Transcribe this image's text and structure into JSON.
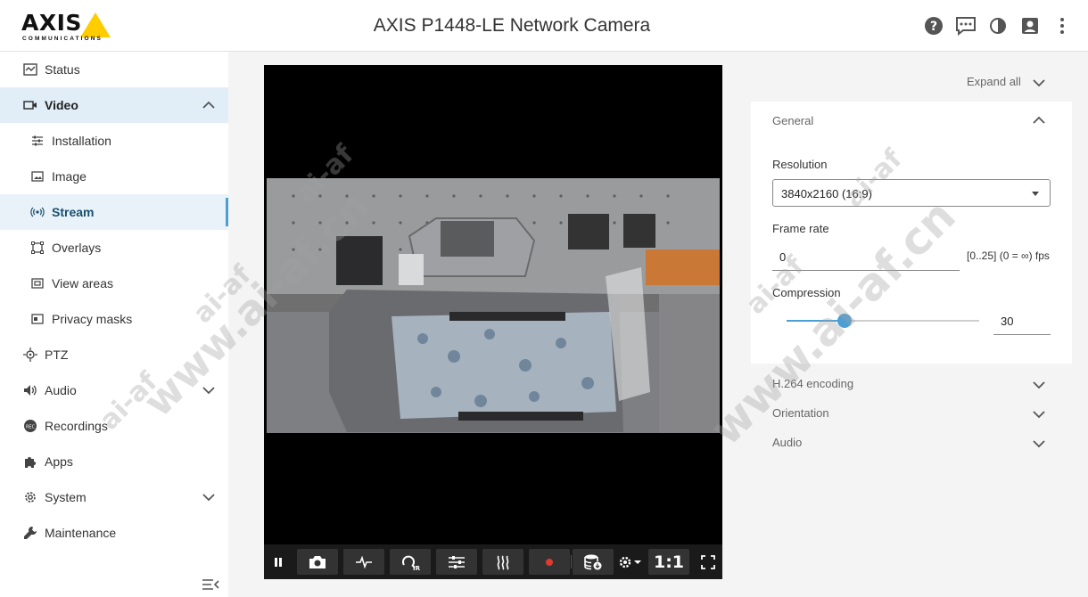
{
  "header": {
    "logo_text": "AXIS",
    "logo_sub": "COMMUNICATIONS",
    "title": "AXIS P1448-LE Network Camera",
    "icons": [
      "help-icon",
      "feedback-icon",
      "contrast-icon",
      "user-icon",
      "more-vertical-icon"
    ]
  },
  "sidebar": {
    "items": [
      {
        "label": "Status",
        "icon": "status-icon"
      },
      {
        "label": "Video",
        "icon": "video-icon"
      },
      {
        "label": "Installation",
        "icon": "sliders-icon"
      },
      {
        "label": "Image",
        "icon": "image-icon"
      },
      {
        "label": "Stream",
        "icon": "stream-icon"
      },
      {
        "label": "Overlays",
        "icon": "overlays-icon"
      },
      {
        "label": "View areas",
        "icon": "view-areas-icon"
      },
      {
        "label": "Privacy masks",
        "icon": "privacy-masks-icon"
      },
      {
        "label": "PTZ",
        "icon": "ptz-icon"
      },
      {
        "label": "Audio",
        "icon": "audio-icon"
      },
      {
        "label": "Recordings",
        "icon": "recordings-icon"
      },
      {
        "label": "Apps",
        "icon": "apps-icon"
      },
      {
        "label": "System",
        "icon": "system-icon"
      },
      {
        "label": "Maintenance",
        "icon": "maintenance-icon"
      }
    ]
  },
  "video": {
    "zoom_label": "1:1",
    "toolbar_icons": [
      "pause-icon",
      "snapshot-icon",
      "pulse-icon",
      "ir-icon",
      "adjust-icon",
      "heat-icon",
      "record-icon",
      "storage-icon",
      "settings-icon",
      "fullscreen-icon"
    ]
  },
  "panel": {
    "expand_all": "Expand all",
    "general_title": "General",
    "resolution_label": "Resolution",
    "resolution_value": "3840x2160 (16:9)",
    "frame_rate_label": "Frame rate",
    "frame_rate_value": "0",
    "frame_rate_range": "[0..25] (0 = ∞) fps",
    "compression_label": "Compression",
    "compression_value": "30",
    "compression_fraction": 0.3,
    "sections": [
      "H.264 encoding",
      "Orientation",
      "Audio"
    ]
  },
  "watermark": {
    "brand": "ai-af",
    "url": "www.ai-af.cn"
  },
  "colors": {
    "accent": "#4a9fd4",
    "logo_yellow": "#ffcc00",
    "record_red": "#e03a2f"
  }
}
